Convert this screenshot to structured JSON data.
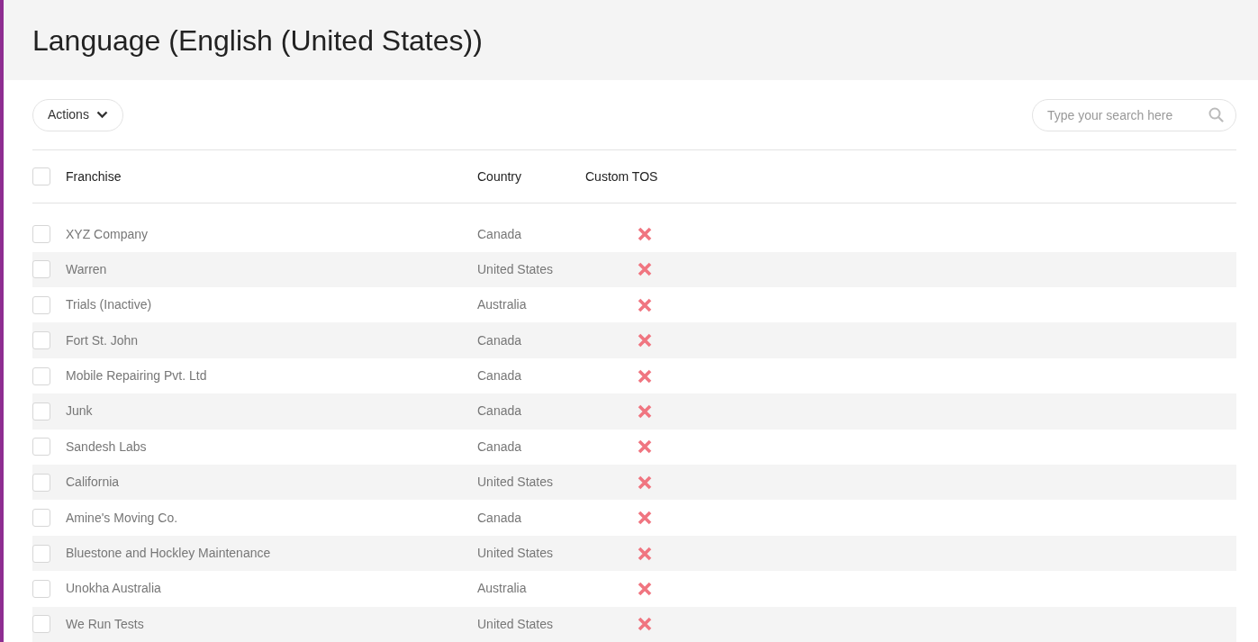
{
  "title": "Language (English (United States))",
  "actions_button": "Actions",
  "search": {
    "placeholder": "Type your search here"
  },
  "table": {
    "select_all_checked": false,
    "columns": [
      "Franchise",
      "Country",
      "Custom TOS"
    ],
    "rows": [
      {
        "franchise": "XYZ Company",
        "country": "Canada",
        "custom_tos": false,
        "checked": false
      },
      {
        "franchise": "Warren",
        "country": "United States",
        "custom_tos": false,
        "checked": false
      },
      {
        "franchise": "Trials (Inactive)",
        "country": "Australia",
        "custom_tos": false,
        "checked": false
      },
      {
        "franchise": "Fort St. John",
        "country": "Canada",
        "custom_tos": false,
        "checked": false
      },
      {
        "franchise": "Mobile Repairing Pvt. Ltd",
        "country": "Canada",
        "custom_tos": false,
        "checked": false
      },
      {
        "franchise": "Junk",
        "country": "Canada",
        "custom_tos": false,
        "checked": false
      },
      {
        "franchise": "Sandesh Labs",
        "country": "Canada",
        "custom_tos": false,
        "checked": false
      },
      {
        "franchise": "California",
        "country": "United States",
        "custom_tos": false,
        "checked": false
      },
      {
        "franchise": "Amine's Moving Co.",
        "country": "Canada",
        "custom_tos": false,
        "checked": false
      },
      {
        "franchise": "Bluestone and Hockley Maintenance",
        "country": "United States",
        "custom_tos": false,
        "checked": false
      },
      {
        "franchise": "Unokha Australia",
        "country": "Australia",
        "custom_tos": false,
        "checked": false
      },
      {
        "franchise": "We Run Tests",
        "country": "United States",
        "custom_tos": false,
        "checked": false
      }
    ]
  }
}
